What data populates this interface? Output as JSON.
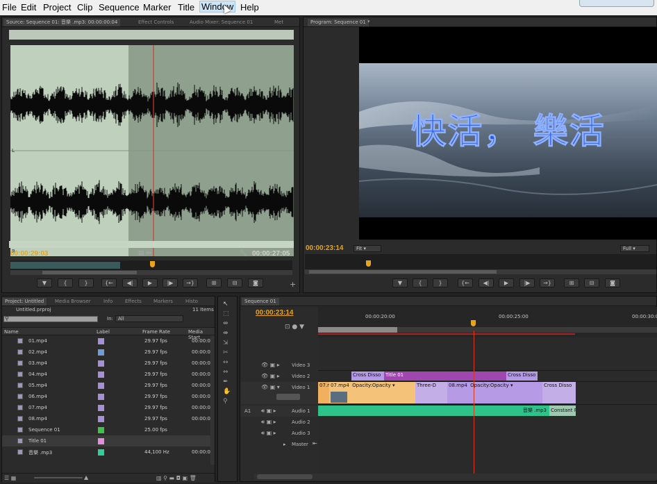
{
  "menu": [
    "File",
    "Edit",
    "Project",
    "Clip",
    "Sequence",
    "Marker",
    "Title",
    "Window",
    "Help"
  ],
  "source": {
    "tabs": [
      "Source: Sequence 01: 音樂 .mp3: 00:00:00:04",
      "Effect Controls",
      "Audio Mixer: Sequence 01",
      "Met"
    ],
    "ch_l": "L",
    "ch_l2": "L",
    "ch_r": "R",
    "ch_r2": "R",
    "tc_in": "00:00:29:03",
    "tc_dur": "00:00:27:05"
  },
  "program": {
    "tab": "Program: Sequence 01",
    "caption": "快活，  樂活",
    "tc": "00:00:23:14",
    "fit": "Fit",
    "quality": "Full"
  },
  "project": {
    "tabs": [
      "Project: Untitled",
      "Media Browser",
      "Info",
      "Effects",
      "Markers",
      "Histo"
    ],
    "file": "Untitled.prproj",
    "count": "11 Items",
    "in_label": "In:",
    "in_value": "All",
    "columns": [
      "Name",
      "Label",
      "Frame Rate",
      "Media Start"
    ],
    "rows": [
      {
        "name": "01.mp4",
        "fps": "29.97 fps",
        "start": "00:00:0",
        "color": "#a78fd8"
      },
      {
        "name": "02.mp4",
        "fps": "29.97 fps",
        "start": "00:00:0",
        "color": "#6f9bd8"
      },
      {
        "name": "03.mp4",
        "fps": "29.97 fps",
        "start": "00:00:0",
        "color": "#a78fd8"
      },
      {
        "name": "04.mp4",
        "fps": "29.97 fps",
        "start": "00:00:0",
        "color": "#a78fd8"
      },
      {
        "name": "05.mp4",
        "fps": "29.97 fps",
        "start": "00:00:0",
        "color": "#a78fd8"
      },
      {
        "name": "06.mp4",
        "fps": "29.97 fps",
        "start": "00:00:0",
        "color": "#a78fd8"
      },
      {
        "name": "07.mp4",
        "fps": "29.97 fps",
        "start": "00:00:0",
        "color": "#a78fd8"
      },
      {
        "name": "08.mp4",
        "fps": "29.97 fps",
        "start": "00:00:0",
        "color": "#a78fd8"
      },
      {
        "name": "Sequence 01",
        "fps": "25.00 fps",
        "start": "",
        "color": "#3ec24a"
      },
      {
        "name": "Title 01",
        "fps": "",
        "start": "",
        "color": "#e28de0"
      },
      {
        "name": "音樂 .mp3",
        "fps": "44,100 Hz",
        "start": "00:00:0",
        "color": "#2fd19a"
      }
    ]
  },
  "timeline": {
    "tab": "Sequence 01",
    "tc": "00:00:23:14",
    "ruler": [
      "00:00:20:00",
      "00:00:25:00",
      "00:00:30:0"
    ],
    "tracks": {
      "v3": "Video 3",
      "v2": "Video 2",
      "v1": "Video 1",
      "a1": "Audio 1",
      "a2": "Audio 2",
      "a3": "Audio 3",
      "master": "Master",
      "a1_src": "A1"
    },
    "clips": {
      "v2_cd1": "Cross Disso",
      "v2_title": "Title 01",
      "v2_cd2": "Cross Disso",
      "v1_07a": "07.r",
      "v1_07b": "07.mp4",
      "v1_op1": "Opacity:Opacity ▾",
      "v1_three": "Three-D",
      "v1_08": "08.mp4",
      "v1_op2": "Opacity:Opacity ▾",
      "v1_cd": "Cross Disso",
      "a1_music": "音樂 .mp3",
      "a1_const": "Constant P"
    }
  }
}
